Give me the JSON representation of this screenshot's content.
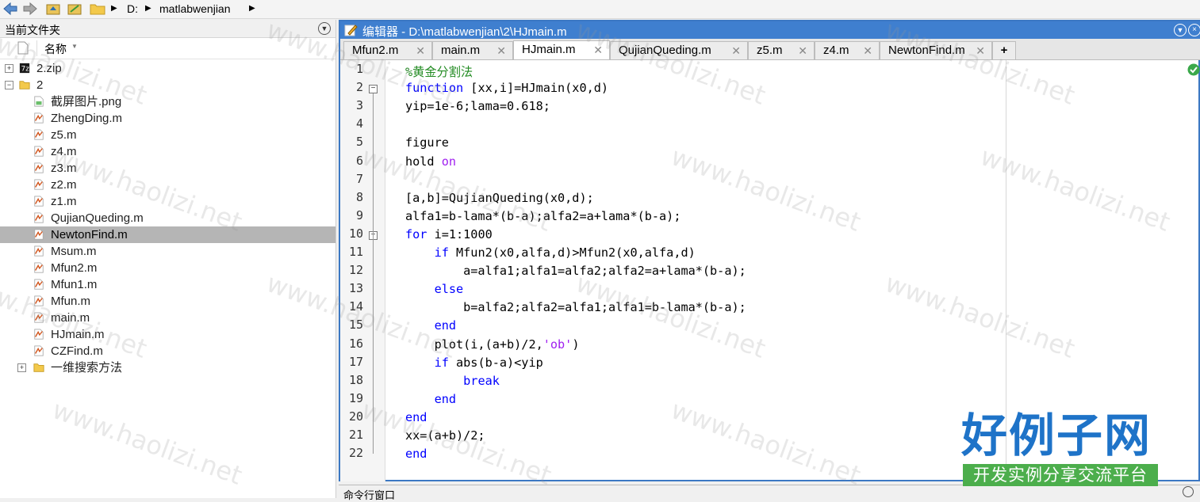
{
  "toolbar": {
    "path": [
      {
        "label": "D:"
      },
      {
        "label": "matlabwenjian"
      }
    ]
  },
  "file_panel": {
    "title": "当前文件夹",
    "column_name": "名称",
    "items": [
      {
        "label": "2.zip",
        "type": "zip",
        "expander": "+",
        "level": 0
      },
      {
        "label": "2",
        "type": "folder",
        "expander": "−",
        "level": 0
      },
      {
        "label": "截屏图片.png",
        "type": "image",
        "level": 1
      },
      {
        "label": "ZhengDing.m",
        "type": "mfile",
        "level": 1
      },
      {
        "label": "z5.m",
        "type": "mfile",
        "level": 1
      },
      {
        "label": "z4.m",
        "type": "mfile",
        "level": 1
      },
      {
        "label": "z3.m",
        "type": "mfile",
        "level": 1
      },
      {
        "label": "z2.m",
        "type": "mfile",
        "level": 1
      },
      {
        "label": "z1.m",
        "type": "mfile",
        "level": 1
      },
      {
        "label": "QujianQueding.m",
        "type": "mfile",
        "level": 1
      },
      {
        "label": "NewtonFind.m",
        "type": "mfile",
        "level": 1,
        "selected": true
      },
      {
        "label": "Msum.m",
        "type": "mfile",
        "level": 1
      },
      {
        "label": "Mfun2.m",
        "type": "mfile",
        "level": 1
      },
      {
        "label": "Mfun1.m",
        "type": "mfile",
        "level": 1
      },
      {
        "label": "Mfun.m",
        "type": "mfile",
        "level": 1
      },
      {
        "label": "main.m",
        "type": "mfile",
        "level": 1
      },
      {
        "label": "HJmain.m",
        "type": "mfile",
        "level": 1
      },
      {
        "label": "CZFind.m",
        "type": "mfile",
        "level": 1
      },
      {
        "label": "一维搜索方法",
        "type": "folder",
        "expander": "+",
        "level": 1
      }
    ]
  },
  "editor": {
    "title": "编辑器 - D:\\matlabwenjian\\2\\HJmain.m",
    "tabs": [
      {
        "label": "Mfun2.m",
        "active": false
      },
      {
        "label": "main.m",
        "active": false
      },
      {
        "label": "HJmain.m",
        "active": true
      },
      {
        "label": "QujianQueding.m",
        "active": false
      },
      {
        "label": "z5.m",
        "active": false
      },
      {
        "label": "z4.m",
        "active": false
      },
      {
        "label": "NewtonFind.m",
        "active": false
      }
    ],
    "add_tab_label": "+",
    "lines": [
      {
        "n": "1",
        "code": "%黄金分割法"
      },
      {
        "n": "2",
        "code": "function [xx,i]=HJmain(x0,d)"
      },
      {
        "n": "3",
        "code": "yip=1e-6;lama=0.618;"
      },
      {
        "n": "4",
        "code": ""
      },
      {
        "n": "5",
        "code": "figure"
      },
      {
        "n": "6",
        "code": "hold on"
      },
      {
        "n": "7",
        "code": ""
      },
      {
        "n": "8",
        "code": "[a,b]=QujianQueding(x0,d);"
      },
      {
        "n": "9",
        "code": "alfa1=b-lama*(b-a);alfa2=a+lama*(b-a);"
      },
      {
        "n": "10",
        "code": "for i=1:1000"
      },
      {
        "n": "11",
        "code": "    if Mfun2(x0,alfa,d)>Mfun2(x0,alfa,d)"
      },
      {
        "n": "12",
        "code": "        a=alfa1;alfa1=alfa2;alfa2=a+lama*(b-a);"
      },
      {
        "n": "13",
        "code": "    else"
      },
      {
        "n": "14",
        "code": "        b=alfa2;alfa2=alfa1;alfa1=b-lama*(b-a);"
      },
      {
        "n": "15",
        "code": "    end"
      },
      {
        "n": "16",
        "code": "    plot(i,(a+b)/2,'ob')"
      },
      {
        "n": "17",
        "code": "    if abs(b-a)<yip"
      },
      {
        "n": "18",
        "code": "        break"
      },
      {
        "n": "19",
        "code": "    end"
      },
      {
        "n": "20",
        "code": "end"
      },
      {
        "n": "21",
        "code": "xx=(a+b)/2;"
      },
      {
        "n": "22",
        "code": "end"
      }
    ]
  },
  "command_window": {
    "title": "命令行窗口"
  },
  "watermark": {
    "text": "www.haolizi.net"
  },
  "logo": {
    "main": "好例子网",
    "sub": "开发实例分享交流平台"
  },
  "colors": {
    "keyword": "#0000ff",
    "comment": "#228b22",
    "string": "#a020f0",
    "title_bar": "#3f7fcf",
    "selection": "#b5b5b5"
  }
}
